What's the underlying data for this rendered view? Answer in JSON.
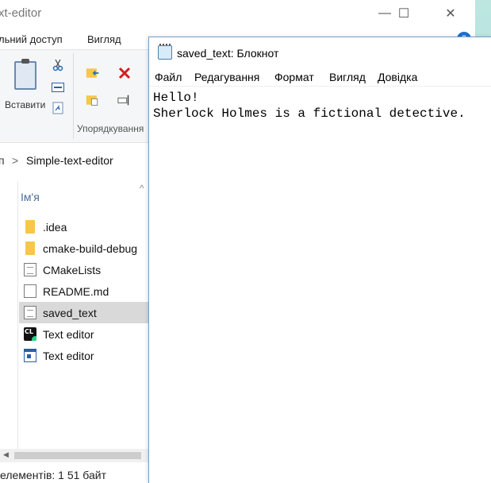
{
  "explorer": {
    "title": "xt-editor",
    "controls": {
      "minimize": "—",
      "maximize": "☐",
      "close": "✕"
    },
    "menu": {
      "share": "льний доступ",
      "view": "Вигляд",
      "help": "?"
    },
    "ribbon": {
      "paste_label": "Вставити",
      "group_organize": "Упорядкування",
      "icons": [
        "cut-icon",
        "copy-path-icon",
        "paste-shortcut-icon",
        "move-to-icon",
        "copy-to-icon",
        "delete-icon",
        "rename-icon"
      ]
    },
    "address": {
      "prefix": "п",
      "separator": ">",
      "folder": "Simple-text-editor"
    },
    "columns": {
      "name": "Ім'я",
      "sort": "^"
    },
    "files": [
      {
        "name": ".idea",
        "icon": "folder-icon"
      },
      {
        "name": "cmake-build-debug",
        "icon": "folder-icon"
      },
      {
        "name": "CMakeLists",
        "icon": "text-file-icon"
      },
      {
        "name": "README.md",
        "icon": "file-icon"
      },
      {
        "name": "saved_text",
        "icon": "text-file-icon",
        "selected": true
      },
      {
        "name": "Text editor",
        "icon": "clion-icon"
      },
      {
        "name": "Text editor",
        "icon": "application-icon"
      }
    ],
    "status": "елементів: 1  51 байт"
  },
  "notepad": {
    "title": "saved_text: Блокнот",
    "menu": {
      "file": "Файл",
      "edit": "Редагування",
      "format": "Формат",
      "view": "Вигляд",
      "help": "Довідка"
    },
    "content": "Hello!\nSherlock Holmes is a fictional detective."
  }
}
